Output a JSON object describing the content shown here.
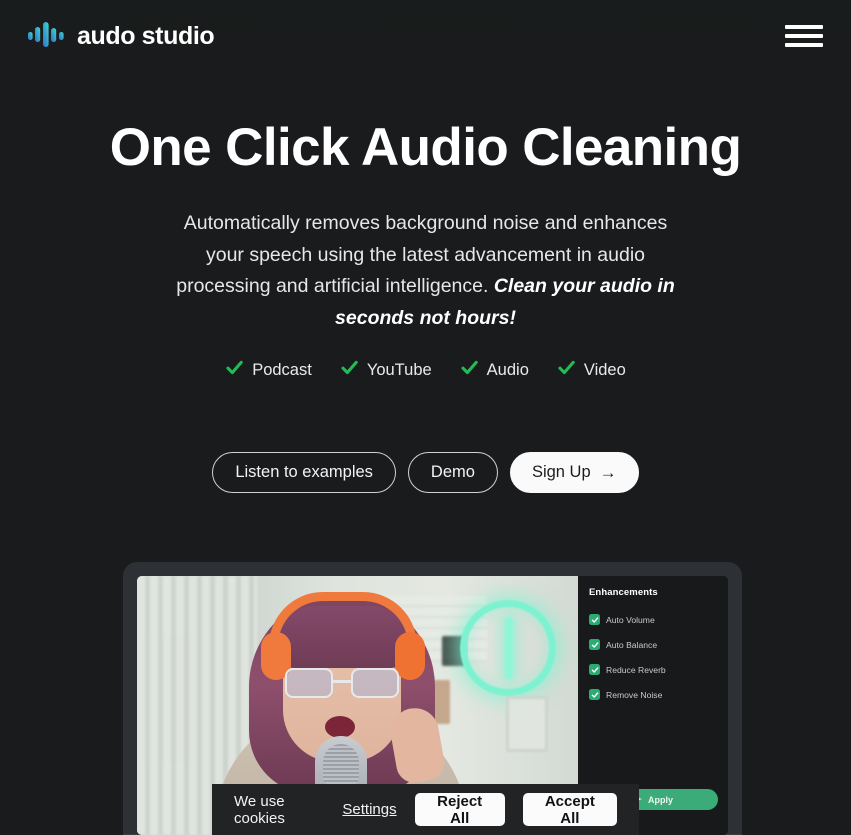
{
  "header": {
    "logo_text": "audo studio",
    "logo_icon": "waveform-icon",
    "menu_icon": "hamburger-menu-icon",
    "logo_colors": {
      "bar_start": "#2f6fd0",
      "bar_end": "#3fd9c9"
    }
  },
  "hero": {
    "title": "One Click Audio Cleaning",
    "subtitle_part1": "Automatically removes background noise and enhances your speech using the latest advancement in audio processing and artificial intelligence. ",
    "subtitle_accent": "Clean your audio in seconds not hours!"
  },
  "features": {
    "check_icon": "check-icon",
    "check_color": "#22bb55",
    "items": [
      {
        "label": "Podcast"
      },
      {
        "label": "YouTube"
      },
      {
        "label": "Audio"
      },
      {
        "label": "Video"
      }
    ]
  },
  "cta": {
    "listen_label": "Listen to examples",
    "demo_label": "Demo",
    "signup_label": "Sign Up",
    "signup_arrow": "→",
    "signup_arrow_icon": "arrow-right-icon"
  },
  "product": {
    "panel_title": "Enhancements",
    "enhancements": [
      {
        "label": "Auto Volume",
        "checked": true
      },
      {
        "label": "Auto Balance",
        "checked": true
      },
      {
        "label": "Reduce Reverb",
        "checked": true
      },
      {
        "label": "Remove Noise",
        "checked": true
      }
    ],
    "apply_label": "Apply",
    "apply_icon": "sparkle-icon",
    "apply_color": "#3aab79",
    "photo_description": "person-with-headphones-at-microphone"
  },
  "cookie_banner": {
    "message": "We use cookies",
    "settings_label": "Settings",
    "reject_label": "Reject All",
    "accept_label": "Accept All"
  },
  "theme": {
    "background": "#1a1b1d",
    "text": "#ffffff",
    "accent_green": "#22bb55"
  }
}
